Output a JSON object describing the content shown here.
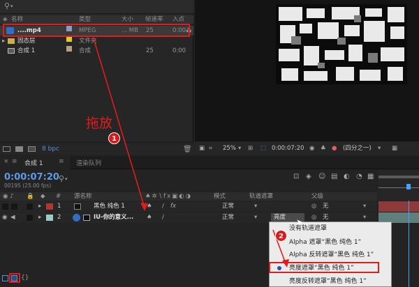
{
  "project": {
    "search_icon": "search-icon",
    "columns": {
      "name": "名称",
      "type": "类型",
      "size": "大小",
      "fps": "帧速率",
      "in": "入点"
    },
    "items": [
      {
        "name": "....mp4",
        "type": "MPEG",
        "size": "... MB",
        "fps": "25",
        "in": "0:00",
        "chip": "#8a9bbd"
      },
      {
        "name": "固态层",
        "type": "文件夹",
        "size": "",
        "fps": "",
        "in": "",
        "chip": "#e0cb2a"
      },
      {
        "name": "合成 1",
        "type": "合成",
        "size": "",
        "fps": "25",
        "in": "0:00",
        "chip": "#b9a07a"
      }
    ],
    "bpc": "8 bpc"
  },
  "viewer": {
    "zoom": "25%",
    "timecode": "0:00:07:20",
    "resolution": "(四分之一)"
  },
  "tabs": [
    {
      "label": "合成 1"
    },
    {
      "label": "渲染队列"
    }
  ],
  "timeline": {
    "timecode": "0:00:07:20",
    "frame_info": "00195 (25.00 fps)",
    "columns": {
      "source": "源名称",
      "mode": "模式",
      "trkmat": "轨道遮罩",
      "parent": "父级"
    },
    "layers": [
      {
        "num": "1",
        "name": "黑色 纯色 1",
        "mode": "正常",
        "trkmat": "",
        "parent": "无",
        "label_color": "#b03535"
      },
      {
        "num": "2",
        "name": "IU-你的意义...",
        "mode": "正常",
        "trkmat": "亮度",
        "parent": "无",
        "label_color": "#9fc9c4"
      }
    ]
  },
  "menu": {
    "items": [
      {
        "label": "没有轨道遮罩",
        "selected": false
      },
      {
        "label": "Alpha 遮罩“黑色 纯色 1”",
        "selected": false
      },
      {
        "label": "Alpha 反转遮罩“黑色 纯色 1”",
        "selected": false
      },
      {
        "label": "亮度遮罩“黑色 纯色 1”",
        "selected": true
      },
      {
        "label": "亮度反转遮罩“黑色 纯色 1”",
        "selected": false
      }
    ]
  },
  "annotations": {
    "drag_label": "拖放",
    "step1": "1",
    "step2": "2",
    "color": "#e11c1c"
  }
}
